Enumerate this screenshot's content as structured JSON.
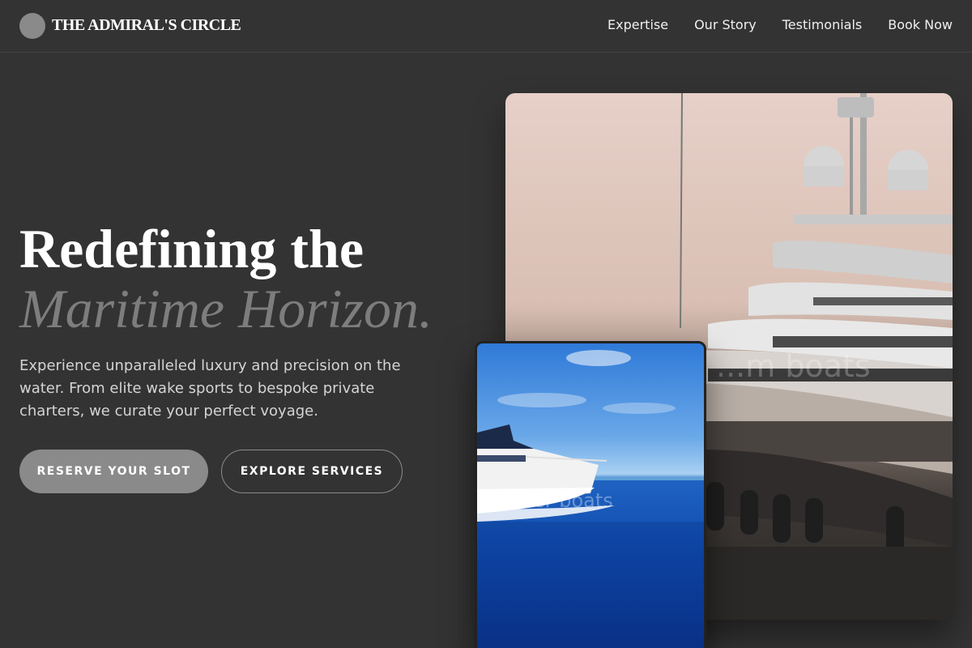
{
  "brand": {
    "name": "THE ADMIRAL'S CIRCLE"
  },
  "nav": {
    "items": [
      {
        "label": "Expertise"
      },
      {
        "label": "Our Story"
      },
      {
        "label": "Testimonials"
      },
      {
        "label": "Book Now"
      }
    ]
  },
  "hero": {
    "title_line1": "Redefining the",
    "title_line2": "Maritime Horizon.",
    "description": "Experience unparalleled luxury and precision on the water. From elite wake sports to bespoke private charters, we curate your perfect voyage.",
    "primary_cta": "RESERVE YOUR SLOT",
    "secondary_cta": "EXPLORE SERVICES"
  },
  "images": {
    "large": {
      "subject": "superyacht-at-dusk",
      "watermark": "...m boats"
    },
    "small": {
      "subject": "motor-yacht-cruising",
      "watermark": "...iter boats"
    }
  },
  "colors": {
    "background": "#333333",
    "accent_gray": "#8a8a8a",
    "muted_title": "#7d7d7d"
  }
}
